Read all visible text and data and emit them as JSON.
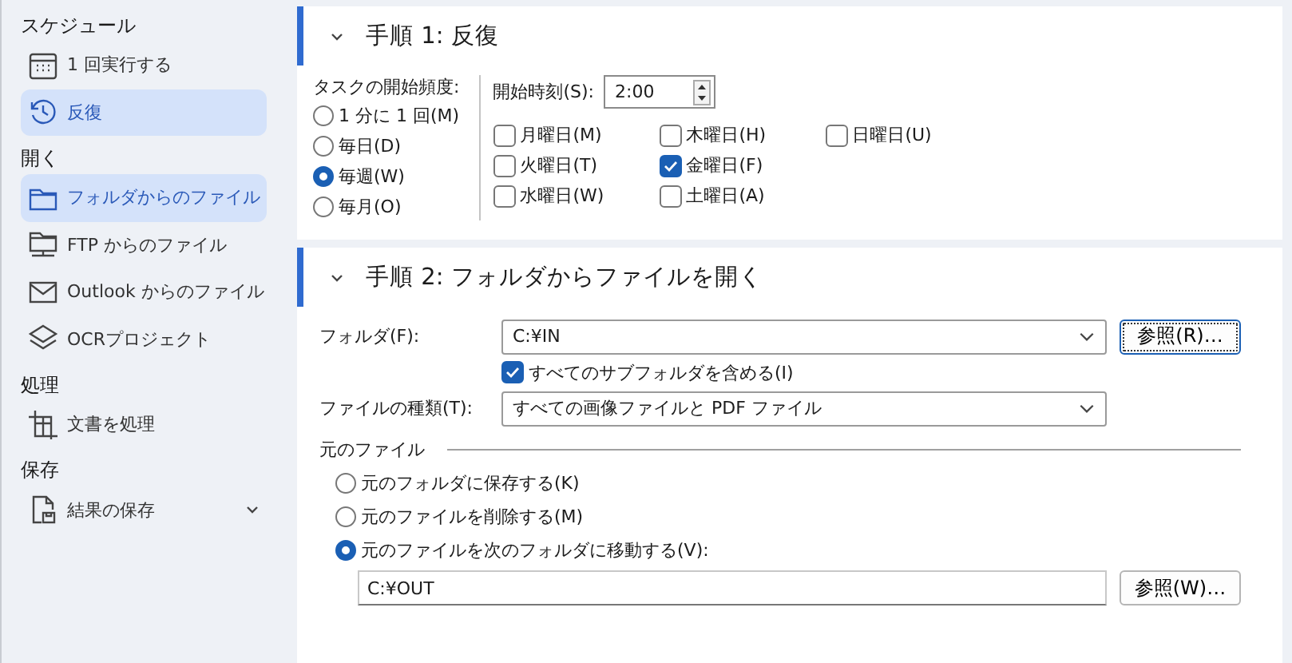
{
  "sidebar": {
    "groups": [
      {
        "title": "スケジュール",
        "items": [
          {
            "label": "1 回実行する",
            "selected": false
          },
          {
            "label": "反復",
            "selected": true
          }
        ]
      },
      {
        "title": "開く",
        "items": [
          {
            "label": "フォルダからのファイル",
            "selected": true
          },
          {
            "label": "FTP からのファイル",
            "selected": false
          },
          {
            "label": "Outlook からのファイル",
            "selected": false
          },
          {
            "label": "OCRプロジェクト",
            "selected": false
          }
        ]
      },
      {
        "title": "処理",
        "items": [
          {
            "label": "文書を処理",
            "selected": false
          }
        ]
      },
      {
        "title": "保存",
        "items": [
          {
            "label": "結果の保存",
            "selected": false,
            "has_menu": true
          }
        ]
      }
    ]
  },
  "step1": {
    "title": "手順 1: 反復",
    "expanded": true,
    "frequency_label": "タスクの開始頻度:",
    "frequency_options": [
      {
        "label": "1 分に 1 回(M)",
        "selected": false
      },
      {
        "label": "毎日(D)",
        "selected": false
      },
      {
        "label": "毎週(W)",
        "selected": true
      },
      {
        "label": "毎月(O)",
        "selected": false
      }
    ],
    "start_time_label": "開始時刻(S):",
    "start_time": "2:00",
    "days": [
      {
        "label": "月曜日(M)",
        "checked": false
      },
      {
        "label": "火曜日(T)",
        "checked": false
      },
      {
        "label": "水曜日(W)",
        "checked": false
      },
      {
        "label": "木曜日(H)",
        "checked": false
      },
      {
        "label": "金曜日(F)",
        "checked": true
      },
      {
        "label": "土曜日(A)",
        "checked": false
      },
      {
        "label": "日曜日(U)",
        "checked": false
      }
    ]
  },
  "step2": {
    "title": "手順 2: フォルダからファイルを開く",
    "expanded": true,
    "folder_label": "フォルダ(F):",
    "folder": "C:¥IN",
    "folder_browse": "参照(R)…",
    "include_subfolders": {
      "label": "すべてのサブフォルダを含める(I)",
      "checked": true
    },
    "file_type_label": "ファイルの種類(T):",
    "file_type": "すべての画像ファイルと PDF ファイル",
    "source_label": "元のファイル",
    "source_options": [
      {
        "label": "元のフォルダに保存する(K)",
        "selected": false
      },
      {
        "label": "元のファイルを削除する(M)",
        "selected": false
      },
      {
        "label": "元のファイルを次のフォルダに移動する(V):",
        "selected": true
      }
    ],
    "move_folder": "C:¥OUT",
    "move_browse": "参照(W)…"
  }
}
